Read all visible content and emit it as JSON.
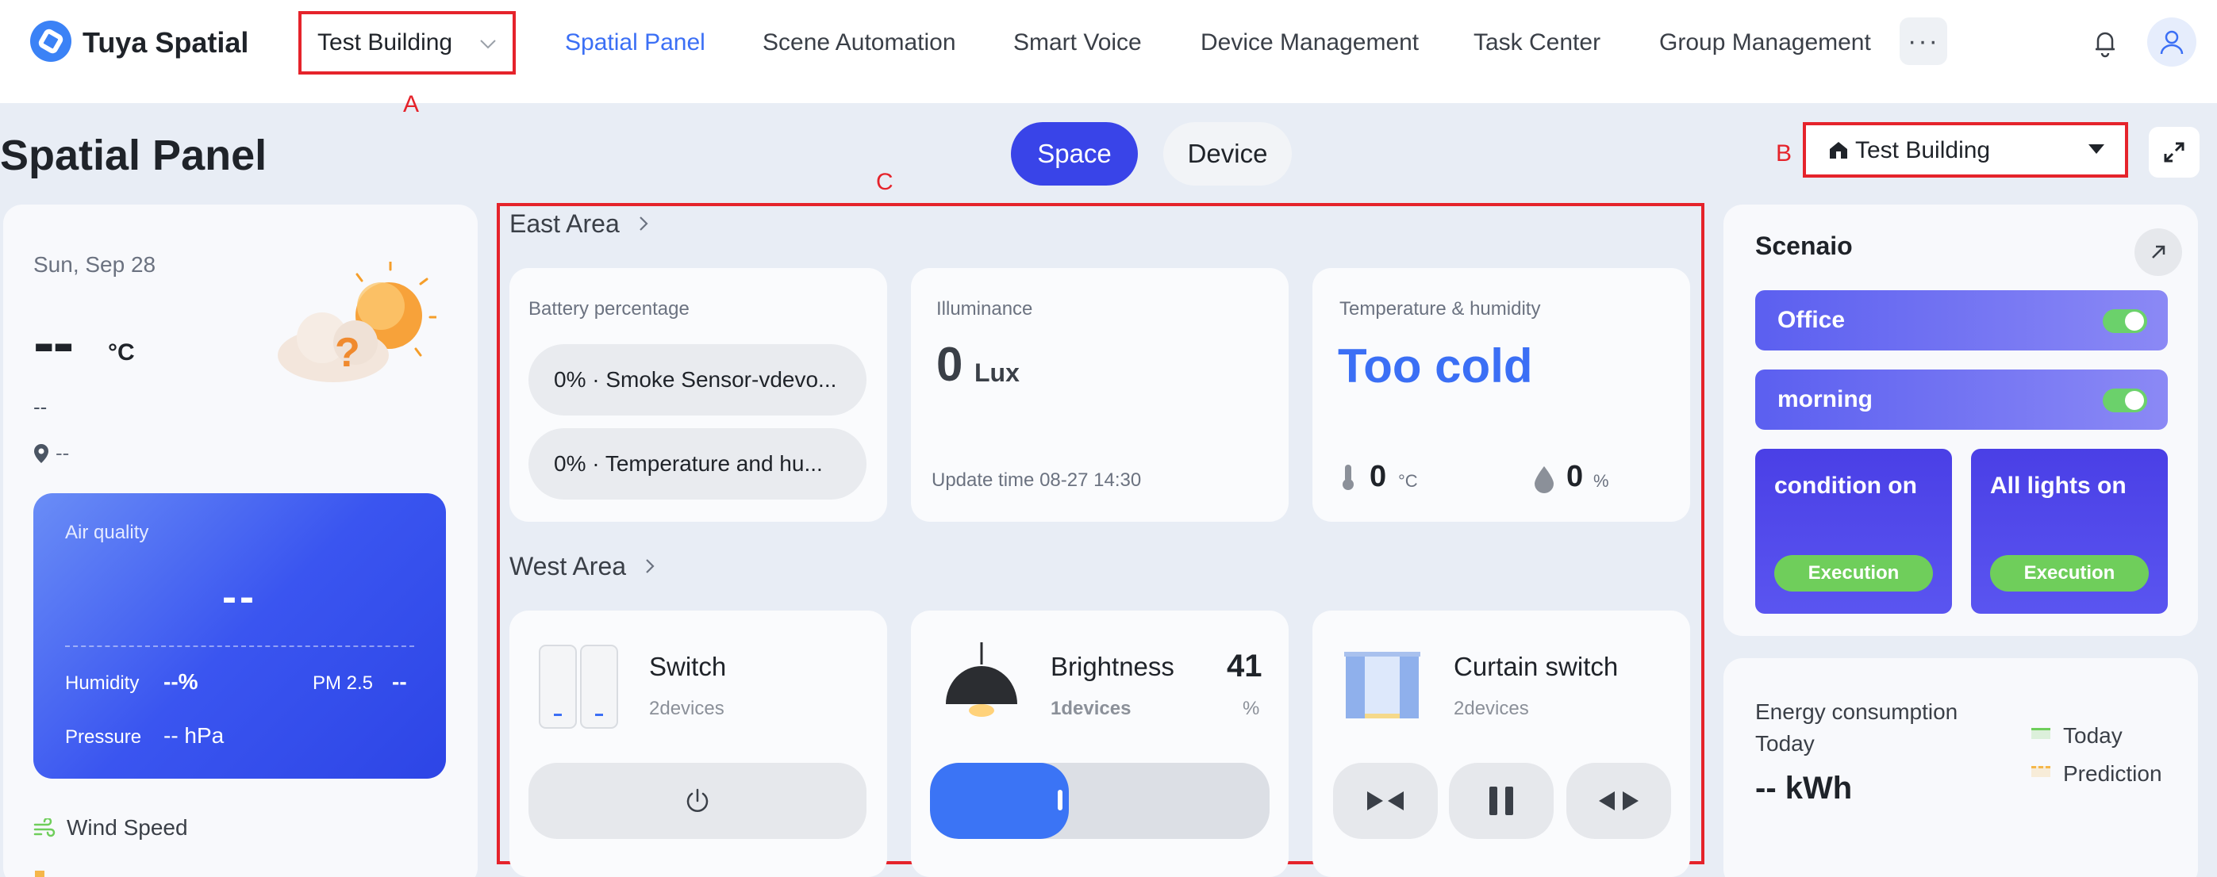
{
  "header": {
    "brand": "Tuya Spatial",
    "building_selector": "Test Building",
    "nav": [
      "Spatial Panel",
      "Scene Automation",
      "Smart Voice",
      "Device Management",
      "Task Center",
      "Group Management"
    ],
    "more": "···"
  },
  "markers": {
    "a": "A",
    "b": "B",
    "c": "C"
  },
  "page": {
    "title": "Spatial Panel",
    "tabs": {
      "space": "Space",
      "device": "Device"
    },
    "building_dropdown": "Test Building"
  },
  "weather": {
    "date": "Sun, Sep 28",
    "temp": "--",
    "unit": "°C",
    "desc": "--",
    "location": "--",
    "air": {
      "title": "Air quality",
      "value": "--",
      "humidity_label": "Humidity",
      "humidity_value": "--%",
      "pm_label": "PM 2.5",
      "pm_value": "--",
      "pressure_label": "Pressure",
      "pressure_value": "-- hPa"
    },
    "wind_label": "Wind Speed"
  },
  "east": {
    "title": "East Area",
    "battery": {
      "label": "Battery percentage",
      "items": [
        "0% · Smoke Sensor-vdevo...",
        "0% · Temperature and hu..."
      ]
    },
    "illuminance": {
      "label": "Illuminance",
      "value": "0",
      "unit": "Lux",
      "update": "Update time 08-27 14:30"
    },
    "temp_humidity": {
      "label": "Temperature & humidity",
      "status": "Too cold",
      "temp": "0",
      "temp_unit": "°C",
      "hum": "0",
      "hum_unit": "%"
    }
  },
  "west": {
    "title": "West Area",
    "switch": {
      "name": "Switch",
      "count": "2devices"
    },
    "brightness": {
      "name": "Brightness",
      "count": "1devices",
      "value": "41",
      "unit": "%",
      "level": 0.41
    },
    "curtain": {
      "name": "Curtain switch",
      "count": "2devices"
    }
  },
  "scenario": {
    "title": "Scenaio",
    "toggles": [
      {
        "label": "Office",
        "on": true
      },
      {
        "label": "morning",
        "on": true
      }
    ],
    "cards": [
      {
        "label": "condition on",
        "button": "Execution"
      },
      {
        "label": "All lights on",
        "button": "Execution"
      }
    ]
  },
  "energy": {
    "title_line1": "Energy consumption",
    "title_line2": "Today",
    "value": "-- kWh",
    "legend": [
      {
        "label": "Today",
        "color": "#6fce5b"
      },
      {
        "label": "Prediction",
        "color": "#f5b74a"
      }
    ]
  },
  "colors": {
    "accent": "#3944e8",
    "marker": "#e5232b",
    "link": "#3b6ff5"
  }
}
